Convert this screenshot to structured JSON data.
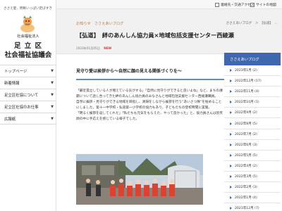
{
  "site": {
    "tagline": "ささえ愛、明晰いっぱい足ばすき",
    "org_type": "社会福祉法人",
    "org_name_line1": "足 立 区",
    "org_name_line2": "社会福祉協議会"
  },
  "left_nav": [
    {
      "label": "トップページ"
    },
    {
      "label": "新着情報"
    },
    {
      "label": "足立区社協について"
    },
    {
      "label": "足立区社協のお仕事"
    },
    {
      "label": "広報紙"
    }
  ],
  "topbar": {
    "access_label": "連絡先・交通アクセス",
    "sitemap_label": "サイトの地図"
  },
  "article": {
    "category_crumb": "お知らせ　ささえあいブログ",
    "breadcrumb": "ささえあいブログ　＞　【弘道】　…",
    "title": "【弘道】　絆のあんしん協力員×地域包括支援センター西綾瀬",
    "date": "2023年01月05日",
    "badge": "NEW",
    "lead": "見守り愛は挨拶から～自然に顔の見える関係づくりを～",
    "paragraphs": [
      "「最近孤立している人が増えている気がする」「自然に見守りができると良いよね」など、まちの課題について話し合ってきた絆のあんしん協力員のみなさんと地域包括支援センター西綾瀬職員。",
      "自然に挨拶・見守りができる地域を目指し、清掃をしながら挨拶を行う“あいさつ隊”を始めることにしました。第十一中学校・弘道第一小学校の協力もあり、子どもたちの登校時間に実施。",
      "「明るく挨拶を返してくれた」「私たちも元気をもらえた、やって良かった」と、協力員さんは皆笑顔の中に手応えを感じている様子でした。"
    ]
  },
  "right_sidebar": {
    "heading": "ささえあいブログ",
    "archives": [
      "2023年1月 (2)",
      "2022年12月 (17)",
      "2022年11月 (4)",
      "2022年10月 (1)",
      "2022年9月 (2)",
      "2022年8月 (5)",
      "2022年7月 (2)",
      "2022年6月 (3)",
      "2022年5月 (5)",
      "2022年4月 (2)",
      "2022年3月 (5)",
      "2022年2月 (3)",
      "2022年1月 (4)",
      "2021年12月 (7)"
    ]
  },
  "colors": {
    "accent_blue": "#3f67b0",
    "crumb_orange": "#d2772d",
    "new_red": "#e23a2a"
  }
}
